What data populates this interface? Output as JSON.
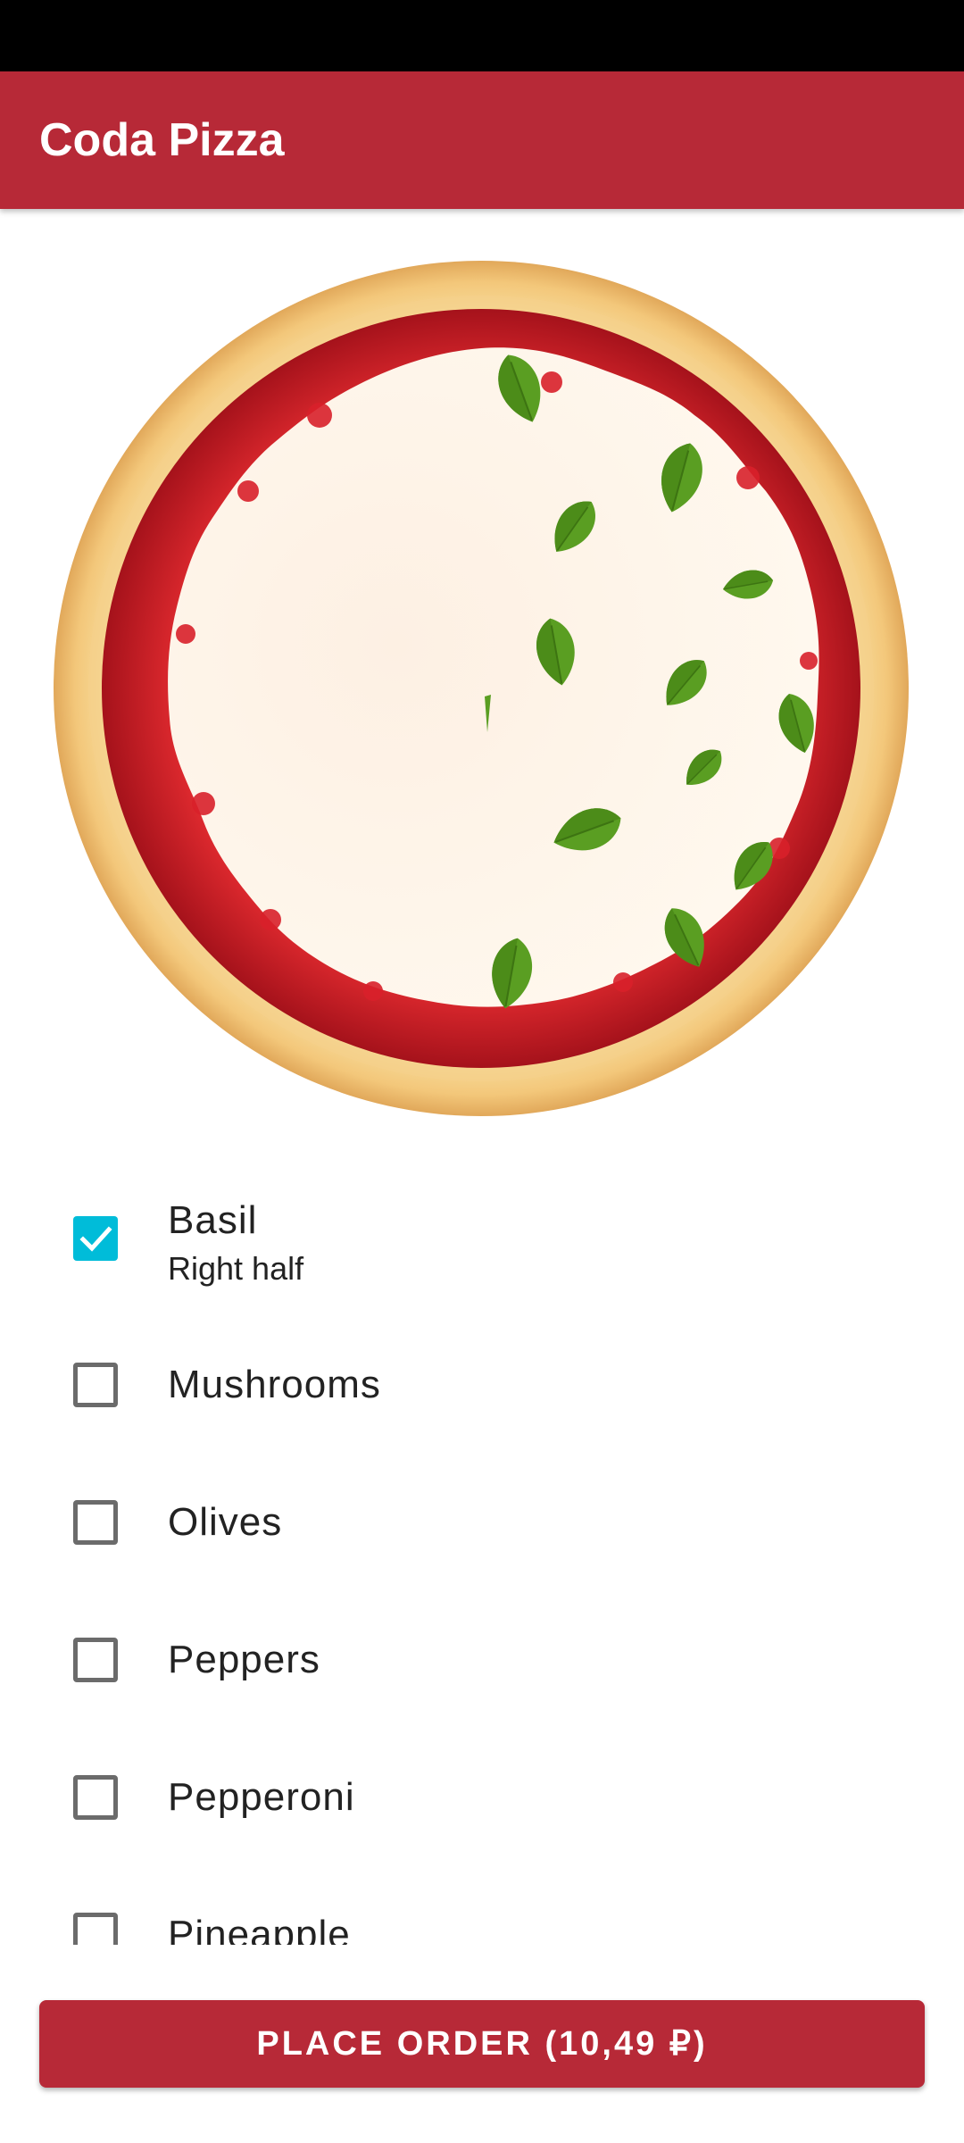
{
  "app": {
    "title": "Coda Pizza"
  },
  "pizza": {
    "topping_shown": "basil",
    "coverage": "right half",
    "colors": {
      "crust": "#f3c77a",
      "sauce": "#d8202a",
      "cheese": "#fdf1e1",
      "basil": "#5a9e22"
    }
  },
  "toppings": [
    {
      "name": "Basil",
      "checked": true,
      "placement": "Right half"
    },
    {
      "name": "Mushrooms",
      "checked": false
    },
    {
      "name": "Olives",
      "checked": false
    },
    {
      "name": "Peppers",
      "checked": false
    },
    {
      "name": "Pepperoni",
      "checked": false
    },
    {
      "name": "Pineapple",
      "checked": false
    }
  ],
  "order": {
    "button_label": "PLACE ORDER (10,49 ₽)"
  },
  "colors": {
    "primary": "#b72937",
    "checkbox_accent": "#00bcd9"
  }
}
